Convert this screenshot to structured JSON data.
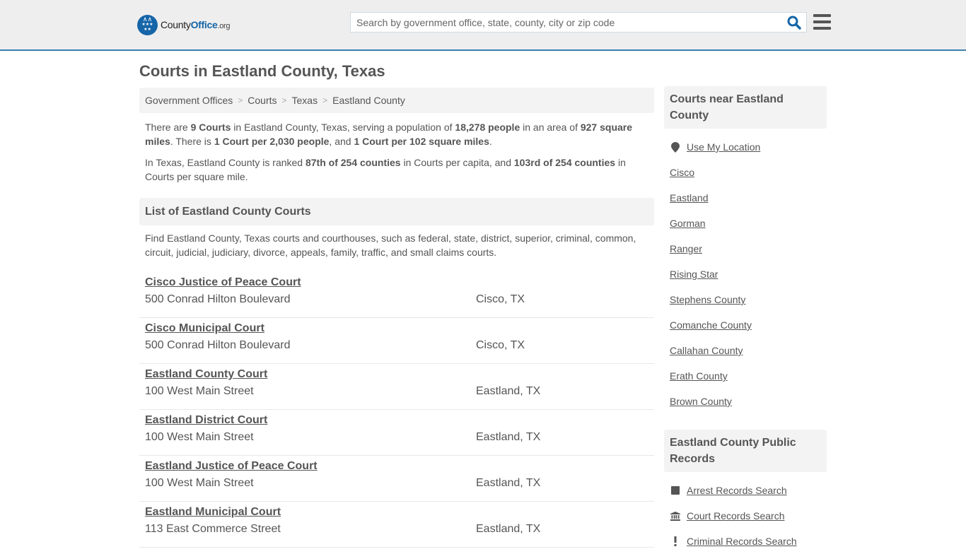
{
  "header": {
    "logo": {
      "county": "County",
      "office": "Office",
      "org": ".org"
    },
    "search": {
      "placeholder": "Search by government office, state, county, city or zip code",
      "value": ""
    },
    "colors": {
      "brand": "#1565a8",
      "header_border": "#3a7fb0",
      "header_bg": "#eeeeee"
    }
  },
  "page": {
    "title": "Courts in Eastland County, Texas",
    "breadcrumb": [
      "Government Offices",
      "Courts",
      "Texas",
      "Eastland County"
    ],
    "summary": {
      "p1": [
        {
          "t": "There are ",
          "b": false
        },
        {
          "t": "9 Courts",
          "b": true
        },
        {
          "t": " in Eastland County, Texas, serving a population of ",
          "b": false
        },
        {
          "t": "18,278 people",
          "b": true
        },
        {
          "t": " in an area of ",
          "b": false
        },
        {
          "t": "927 square miles",
          "b": true
        },
        {
          "t": ". There is ",
          "b": false
        },
        {
          "t": "1 Court per 2,030 people",
          "b": true
        },
        {
          "t": ", and ",
          "b": false
        },
        {
          "t": "1 Court per 102 square miles",
          "b": true
        },
        {
          "t": ".",
          "b": false
        }
      ],
      "p2": [
        {
          "t": "In Texas, Eastland County is ranked ",
          "b": false
        },
        {
          "t": "87th of 254 counties",
          "b": true
        },
        {
          "t": " in Courts per capita, and ",
          "b": false
        },
        {
          "t": "103rd of 254 counties",
          "b": true
        },
        {
          "t": " in Courts per square mile.",
          "b": false
        }
      ]
    },
    "list_section": {
      "heading": "List of Eastland County Courts",
      "description": "Find Eastland County, Texas courts and courthouses, such as federal, state, district, superior, criminal, common, circuit, judicial, judiciary, divorce, appeals, family, traffic, and small claims courts."
    },
    "courts": [
      {
        "name": "Cisco Justice of Peace Court",
        "address": "500 Conrad Hilton Boulevard",
        "city": "Cisco, TX"
      },
      {
        "name": "Cisco Municipal Court",
        "address": "500 Conrad Hilton Boulevard",
        "city": "Cisco, TX"
      },
      {
        "name": "Eastland County Court",
        "address": "100 West Main Street",
        "city": "Eastland, TX"
      },
      {
        "name": "Eastland District Court",
        "address": "100 West Main Street",
        "city": "Eastland, TX"
      },
      {
        "name": "Eastland Justice of Peace Court",
        "address": "100 West Main Street",
        "city": "Eastland, TX"
      },
      {
        "name": "Eastland Municipal Court",
        "address": "113 East Commerce Street",
        "city": "Eastland, TX"
      }
    ]
  },
  "sidebar": {
    "nearby": {
      "heading": "Courts near Eastland County",
      "use_location": {
        "label": "Use My Location",
        "icon": "map-marker-icon"
      },
      "links": [
        "Cisco",
        "Eastland",
        "Gorman",
        "Ranger",
        "Rising Star",
        "Stephens County",
        "Comanche County",
        "Callahan County",
        "Erath County",
        "Brown County"
      ]
    },
    "records": {
      "heading": "Eastland County Public Records",
      "links": [
        {
          "label": "Arrest Records Search",
          "icon": "square-icon"
        },
        {
          "label": "Court Records Search",
          "icon": "courthouse-icon"
        },
        {
          "label": "Criminal Records Search",
          "icon": "exclamation-icon"
        }
      ]
    }
  }
}
